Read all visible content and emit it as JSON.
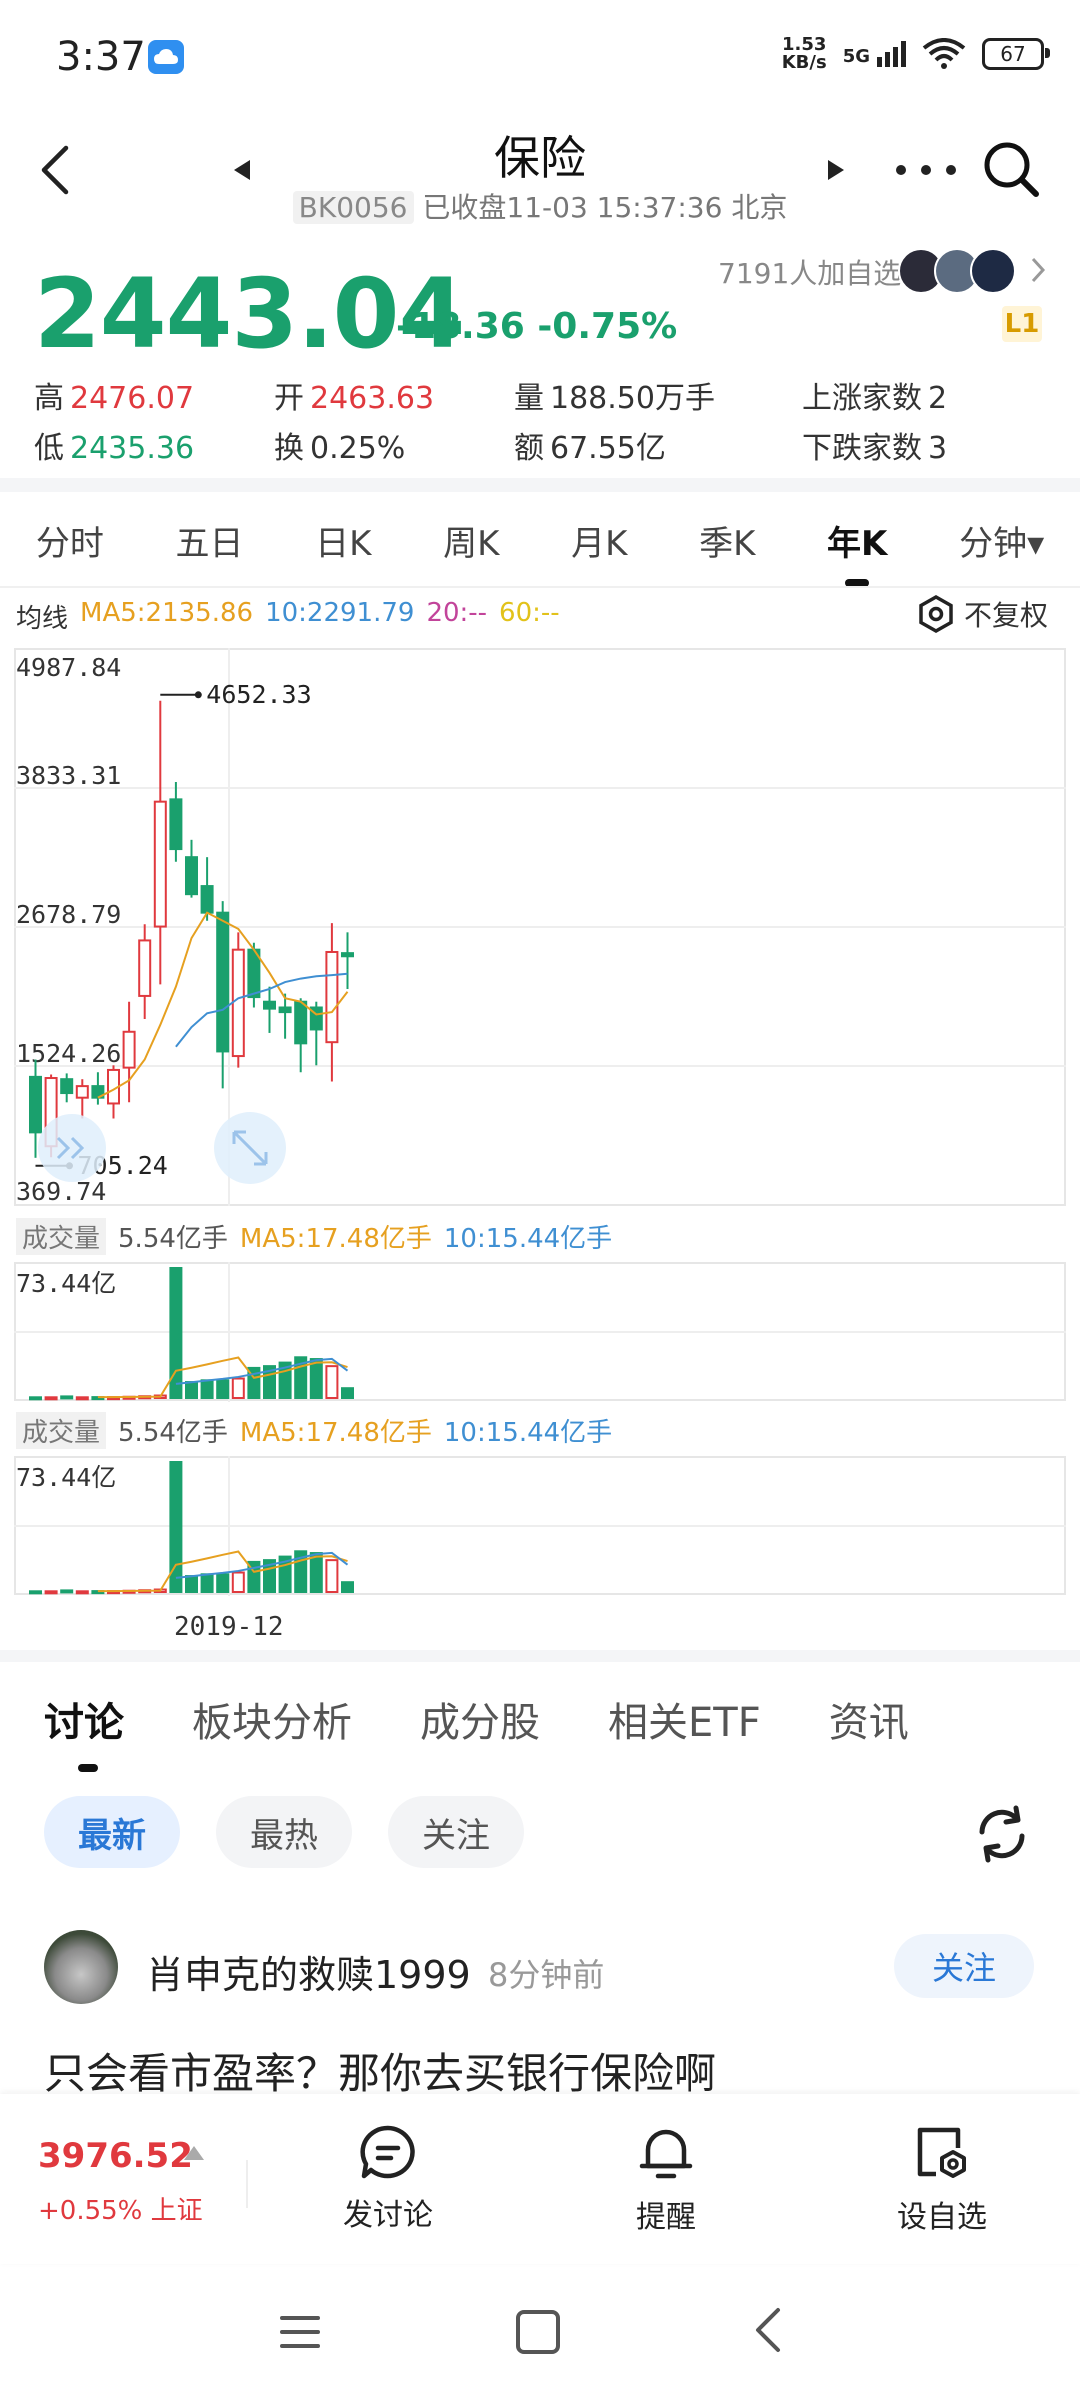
{
  "status_bar": {
    "time": "3:37",
    "net_speed_top": "1.53",
    "net_speed_unit": "KB/s",
    "network": "5G",
    "battery": "67"
  },
  "header": {
    "title": "保险",
    "code": "BK0056",
    "status": "已收盘11-03 15:37:36 北京"
  },
  "quote": {
    "price": "2443.04",
    "change": "-18.36",
    "change_pct": "-0.75%",
    "followers": "7191人加自选",
    "level_badge": "L1",
    "stats": [
      [
        {
          "label": "高",
          "value": "2476.07",
          "color": "red"
        },
        {
          "label": "开",
          "value": "2463.63",
          "color": "red"
        },
        {
          "label": "量",
          "value": "188.50万手",
          "color": "plain"
        },
        {
          "label": "上涨家数",
          "value": "2",
          "color": "plain"
        }
      ],
      [
        {
          "label": "低",
          "value": "2435.36",
          "color": "green"
        },
        {
          "label": "换",
          "value": "0.25%",
          "color": "plain"
        },
        {
          "label": "额",
          "value": "67.55亿",
          "color": "plain"
        },
        {
          "label": "下跌家数",
          "value": "3",
          "color": "plain"
        }
      ]
    ]
  },
  "period_tabs": [
    "分时",
    "五日",
    "日K",
    "周K",
    "月K",
    "季K",
    "年K",
    "分钟▾"
  ],
  "active_period": "年K",
  "ma": {
    "label": "均线",
    "ma5": "MA5:2135.86",
    "ma10": "10:2291.79",
    "ma20": "20:--",
    "ma60": "60:--"
  },
  "fuquan_label": "不复权",
  "chart_axis": {
    "y_labels": [
      "4987.84",
      "3833.31",
      "2678.79",
      "1524.26",
      "369.74"
    ],
    "high_marker": "4652.33",
    "low_marker": "705.24",
    "date_label": "2019-12"
  },
  "volume_panels": [
    {
      "tag": "成交量",
      "value": "5.54亿手",
      "ma5": "MA5:17.48亿手",
      "ma10": "10:15.44亿手",
      "max_label": "73.44亿"
    },
    {
      "tag": "成交量",
      "value": "5.54亿手",
      "ma5": "MA5:17.48亿手",
      "ma10": "10:15.44亿手",
      "max_label": "73.44亿"
    }
  ],
  "chart_data": {
    "type": "candlestick",
    "ylim": [
      369.74,
      4987.84
    ],
    "candles": [
      {
        "o": 1400,
        "h": 1550,
        "l": 700,
        "c": 920
      },
      {
        "o": 800,
        "h": 1420,
        "l": 705.24,
        "c": 1390
      },
      {
        "o": 1380,
        "h": 1430,
        "l": 1180,
        "c": 1260
      },
      {
        "o": 1220,
        "h": 1380,
        "l": 1040,
        "c": 1320
      },
      {
        "o": 1320,
        "h": 1440,
        "l": 1160,
        "c": 1220
      },
      {
        "o": 1170,
        "h": 1500,
        "l": 1040,
        "c": 1460
      },
      {
        "o": 1480,
        "h": 2050,
        "l": 1180,
        "c": 1790
      },
      {
        "o": 2100,
        "h": 2720,
        "l": 1900,
        "c": 2580
      },
      {
        "o": 2700,
        "h": 4652.33,
        "l": 2200,
        "c": 3780
      },
      {
        "o": 3800,
        "h": 3950,
        "l": 3260,
        "c": 3370
      },
      {
        "o": 3300,
        "h": 3450,
        "l": 2950,
        "c": 2980
      },
      {
        "o": 3050,
        "h": 3300,
        "l": 2750,
        "c": 2820
      },
      {
        "o": 2820,
        "h": 2920,
        "l": 1300,
        "c": 1620
      },
      {
        "o": 1580,
        "h": 2650,
        "l": 1480,
        "c": 2500
      },
      {
        "o": 2500,
        "h": 2560,
        "l": 2000,
        "c": 2090
      },
      {
        "o": 2050,
        "h": 2180,
        "l": 1780,
        "c": 1990
      },
      {
        "o": 2000,
        "h": 2120,
        "l": 1730,
        "c": 1960
      },
      {
        "o": 2050,
        "h": 2080,
        "l": 1440,
        "c": 1690
      },
      {
        "o": 2000,
        "h": 2050,
        "l": 1500,
        "c": 1810
      },
      {
        "o": 1700,
        "h": 2730,
        "l": 1360,
        "c": 2480
      },
      {
        "o": 2470,
        "h": 2650,
        "l": 2160,
        "c": 2443.04
      }
    ],
    "ma5": [
      null,
      null,
      null,
      null,
      1220,
      1290,
      1370,
      1550,
      1850,
      2180,
      2600,
      2820,
      2750,
      2680,
      2500,
      2300,
      2080,
      2050,
      1940,
      1960,
      2135.86
    ],
    "ma10": [
      null,
      null,
      null,
      null,
      null,
      null,
      null,
      null,
      null,
      1660,
      1830,
      1950,
      1980,
      2080,
      2120,
      2160,
      2220,
      2250,
      2270,
      2280,
      2291.79
    ],
    "volume": [
      0.4,
      0.4,
      0.9,
      0.4,
      0.5,
      0.5,
      0.7,
      1.0,
      1.4,
      73.44,
      9.0,
      10.0,
      10.0,
      11.0,
      17.0,
      18.0,
      20.0,
      23.0,
      22.0,
      18.0,
      5.54
    ],
    "vol_ma5": [
      null,
      null,
      null,
      null,
      0.5,
      0.5,
      0.6,
      0.7,
      0.8,
      15.4,
      17.1,
      19.0,
      21.0,
      22.9,
      11.4,
      13.2,
      15.2,
      17.8,
      20.0,
      20.2,
      17.48
    ],
    "vol_ma10": [
      null,
      null,
      null,
      null,
      null,
      null,
      null,
      null,
      null,
      8.0,
      8.9,
      9.9,
      10.8,
      11.9,
      13.6,
      15.3,
      17.2,
      19.4,
      21.4,
      22.1,
      15.44
    ],
    "up_color": "#e0393e",
    "down_color": "#1aa06d",
    "ma5_color": "#e6a020",
    "ma10_color": "#3f8fd2"
  },
  "discussion_tabs": [
    "讨论",
    "板块分析",
    "成分股",
    "相关ETF",
    "资讯"
  ],
  "active_discussion_tab": "讨论",
  "filters": [
    "最新",
    "最热",
    "关注"
  ],
  "active_filter": "最新",
  "post": {
    "user": "肖申克的救赎1999",
    "time": "8分钟前",
    "follow": "关注",
    "text": "只会看市盈率？那你去买银行保险啊"
  },
  "bottom_bar": {
    "index_value": "3976.52",
    "index_change": "+0.55% 上证",
    "actions": [
      "发讨论",
      "提醒",
      "设自选"
    ]
  }
}
